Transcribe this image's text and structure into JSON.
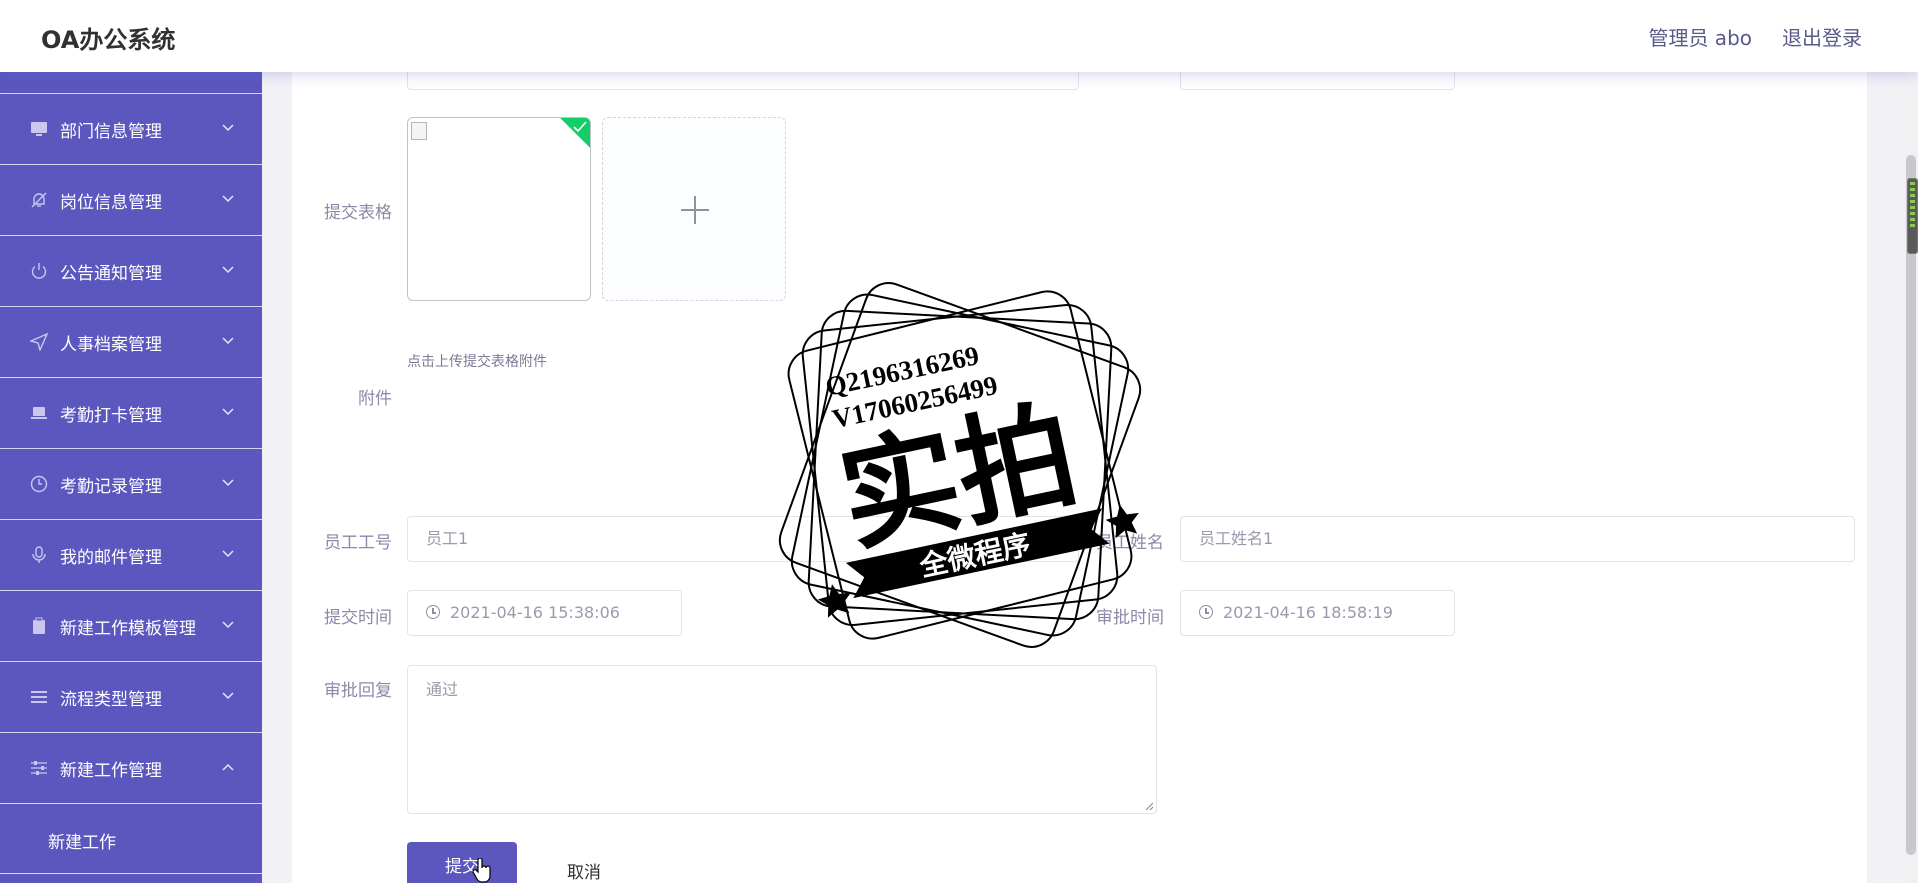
{
  "header": {
    "logo": "OA办公系统",
    "admin": "管理员 abo",
    "logout": "退出登录"
  },
  "sidebar": {
    "items": [
      {
        "label": "部门信息管理",
        "icon": "monitor-icon"
      },
      {
        "label": "岗位信息管理",
        "icon": "bell-off-icon"
      },
      {
        "label": "公告通知管理",
        "icon": "power-icon"
      },
      {
        "label": "人事档案管理",
        "icon": "send-icon"
      },
      {
        "label": "考勤打卡管理",
        "icon": "laptop-icon"
      },
      {
        "label": "考勤记录管理",
        "icon": "clock-icon"
      },
      {
        "label": "我的邮件管理",
        "icon": "microphone-icon"
      },
      {
        "label": "新建工作模板管理",
        "icon": "clipboard-icon"
      },
      {
        "label": "流程类型管理",
        "icon": "list-icon"
      },
      {
        "label": "新建工作管理",
        "icon": "sliders-icon",
        "expanded": true
      }
    ],
    "subitem": "新建工作"
  },
  "form": {
    "submit_table_label": "提交表格",
    "upload_tip": "点击上传提交表格附件",
    "attachment_label": "附件",
    "employee_no_label": "员工工号",
    "employee_no_value": "员工1",
    "employee_name_label": "员工姓名",
    "employee_name_value": "员工姓名1",
    "submit_time_label": "提交时间",
    "submit_time_value": "2021-04-16 15:38:06",
    "approve_time_label": "审批时间",
    "approve_time_value": "2021-04-16 18:58:19",
    "reply_label": "审批回复",
    "reply_value": "通过",
    "submit_button": "提交",
    "cancel_button": "取消"
  },
  "watermark": {
    "line1": "Q2196316269",
    "line2": "V17060256499",
    "big": "实拍",
    "banner": "全微程序"
  },
  "colors": {
    "sidebar": "#5b57bf",
    "primary": "#5b57bf",
    "success": "#13ce66"
  }
}
